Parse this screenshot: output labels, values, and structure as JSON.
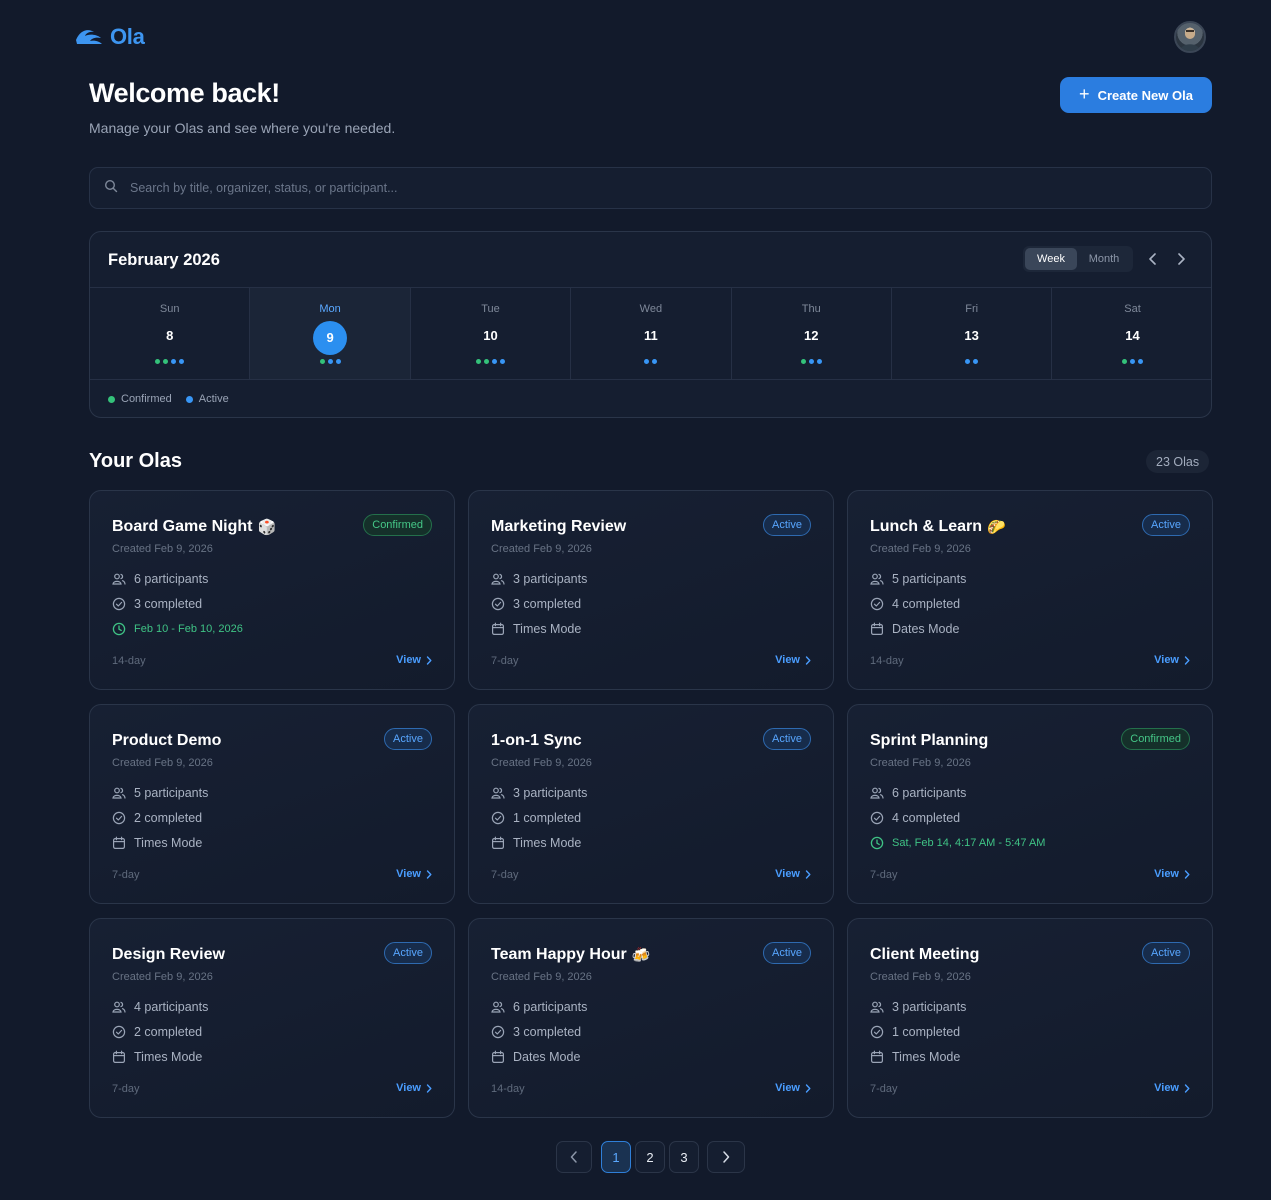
{
  "brand": {
    "name": "Ola"
  },
  "header": {
    "title": "Welcome back!",
    "subtitle": "Manage your Olas and see where you're needed.",
    "create_label": "Create New Ola"
  },
  "search": {
    "placeholder": "Search by title, organizer, status, or participant..."
  },
  "calendar": {
    "title": "February 2026",
    "view_week": "Week",
    "view_month": "Month",
    "active_view": "Week",
    "days": [
      {
        "name": "Sun",
        "num": "8",
        "dots": [
          "g",
          "g",
          "b",
          "b"
        ],
        "today": false
      },
      {
        "name": "Mon",
        "num": "9",
        "dots": [
          "g",
          "b",
          "b"
        ],
        "today": true
      },
      {
        "name": "Tue",
        "num": "10",
        "dots": [
          "g",
          "g",
          "b",
          "b"
        ],
        "today": false
      },
      {
        "name": "Wed",
        "num": "11",
        "dots": [
          "b",
          "b"
        ],
        "today": false
      },
      {
        "name": "Thu",
        "num": "12",
        "dots": [
          "g",
          "b",
          "b"
        ],
        "today": false
      },
      {
        "name": "Fri",
        "num": "13",
        "dots": [
          "b",
          "b"
        ],
        "today": false
      },
      {
        "name": "Sat",
        "num": "14",
        "dots": [
          "g",
          "b",
          "b"
        ],
        "today": false
      }
    ],
    "legend": {
      "confirmed": "Confirmed",
      "active": "Active"
    },
    "colors": {
      "confirmed": "#34c27a",
      "active": "#3896f5"
    }
  },
  "olas": {
    "title": "Your Olas",
    "count": "23 Olas",
    "view_label": "View",
    "cards": [
      {
        "title": "Board Game Night",
        "emoji": "🎲",
        "status": "Confirmed",
        "created": "Created Feb 9, 2026",
        "participants": "6 participants",
        "completed": "3 completed",
        "detail": "Feb 10 - Feb 10, 2026",
        "detail_type": "time",
        "duration": "14-day"
      },
      {
        "title": "Marketing Review",
        "emoji": "",
        "status": "Active",
        "created": "Created Feb 9, 2026",
        "participants": "3 participants",
        "completed": "3 completed",
        "detail": "Times Mode",
        "detail_type": "mode",
        "duration": "7-day"
      },
      {
        "title": "Lunch & Learn",
        "emoji": "🌮",
        "status": "Active",
        "created": "Created Feb 9, 2026",
        "participants": "5 participants",
        "completed": "4 completed",
        "detail": "Dates Mode",
        "detail_type": "mode",
        "duration": "14-day"
      },
      {
        "title": "Product Demo",
        "emoji": "",
        "status": "Active",
        "created": "Created Feb 9, 2026",
        "participants": "5 participants",
        "completed": "2 completed",
        "detail": "Times Mode",
        "detail_type": "mode",
        "duration": "7-day"
      },
      {
        "title": "1-on-1 Sync",
        "emoji": "",
        "status": "Active",
        "created": "Created Feb 9, 2026",
        "participants": "3 participants",
        "completed": "1 completed",
        "detail": "Times Mode",
        "detail_type": "mode",
        "duration": "7-day"
      },
      {
        "title": "Sprint Planning",
        "emoji": "",
        "status": "Confirmed",
        "created": "Created Feb 9, 2026",
        "participants": "6 participants",
        "completed": "4 completed",
        "detail": "Sat, Feb 14, 4:17 AM - 5:47 AM",
        "detail_type": "time",
        "duration": "7-day"
      },
      {
        "title": "Design Review",
        "emoji": "",
        "status": "Active",
        "created": "Created Feb 9, 2026",
        "participants": "4 participants",
        "completed": "2 completed",
        "detail": "Times Mode",
        "detail_type": "mode",
        "duration": "7-day"
      },
      {
        "title": "Team Happy Hour",
        "emoji": "🍻",
        "status": "Active",
        "created": "Created Feb 9, 2026",
        "participants": "6 participants",
        "completed": "3 completed",
        "detail": "Dates Mode",
        "detail_type": "mode",
        "duration": "14-day"
      },
      {
        "title": "Client Meeting",
        "emoji": "",
        "status": "Active",
        "created": "Created Feb 9, 2026",
        "participants": "3 participants",
        "completed": "1 completed",
        "detail": "Times Mode",
        "detail_type": "mode",
        "duration": "7-day"
      }
    ]
  },
  "pagination": {
    "pages": [
      "1",
      "2",
      "3"
    ],
    "current": "1"
  }
}
